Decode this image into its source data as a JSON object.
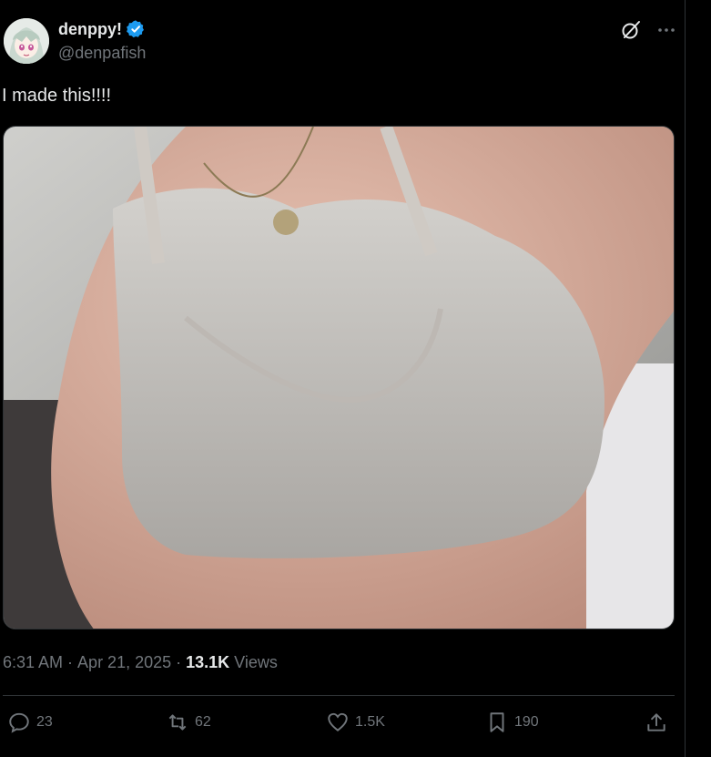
{
  "tweet": {
    "display_name": "denppy!",
    "handle": "@denpafish",
    "verified_icon": "verified-badge-icon",
    "text": "I made this!!!!",
    "media_alt": "photo",
    "time": "6:31 AM",
    "date": "Apr 21, 2025",
    "views_count": "13.1K",
    "views_label": "Views"
  },
  "actions": {
    "reply": "23",
    "retweet": "62",
    "like": "1.5K",
    "bookmark": "190"
  },
  "colors": {
    "background": "#000000",
    "text": "#e7e9ea",
    "muted": "#71767b",
    "verified": "#1d9bf0",
    "divider": "#2f3336"
  }
}
